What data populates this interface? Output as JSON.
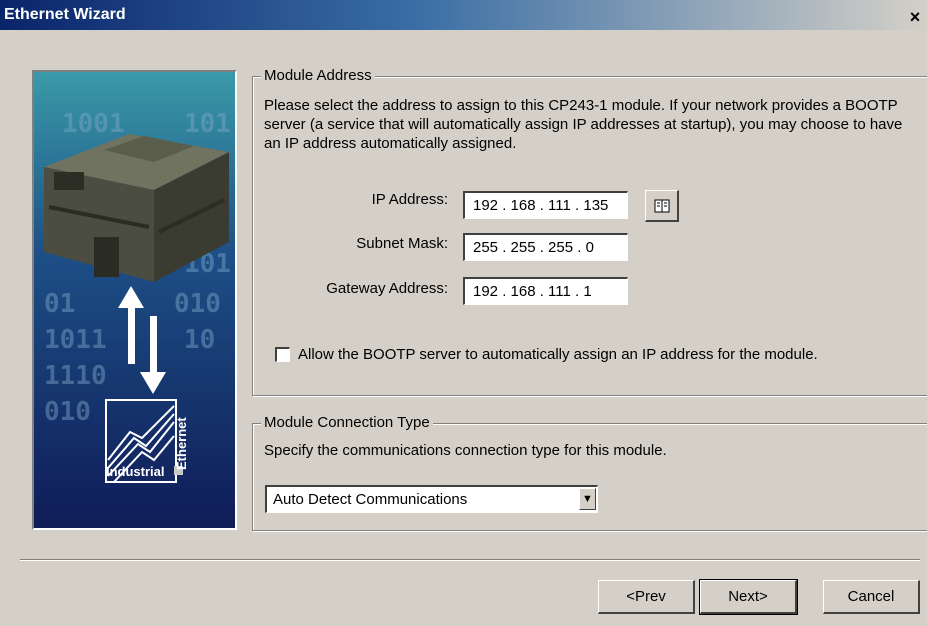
{
  "window": {
    "title": "Ethernet Wizard",
    "close_glyph": "×"
  },
  "banner": {
    "bits_rows": [
      "1001",
      "101",
      "101",
      "01",
      "010",
      "1011",
      "10",
      "1110",
      "010"
    ],
    "logo_industrial": "Industrial",
    "logo_ethernet": "Ethernet"
  },
  "module_address": {
    "legend": "Module Address",
    "description": "Please select the address to assign to this CP243-1 module. If your network provides a BOOTP server (a service that will automatically assign IP addresses at startup), you may choose to have an IP address automatically assigned.",
    "ip_label": "IP Address:",
    "ip_value": "192 . 168 . 111 . 135",
    "subnet_label": "Subnet Mask:",
    "subnet_value": "255 . 255 . 255 .  0",
    "gateway_label": "Gateway Address:",
    "gateway_value": "192 . 168 . 111 .  1",
    "bootp_label": "Allow the BOOTP server to automatically assign an IP address for the module.",
    "bootp_checked": false,
    "address_book_icon": "address-book-icon"
  },
  "connection_type": {
    "legend": "Module Connection Type",
    "description": "Specify the communications connection type for this module.",
    "selected": "Auto Detect Communications"
  },
  "buttons": {
    "prev": "<Prev",
    "next": "Next>",
    "cancel": "Cancel"
  }
}
